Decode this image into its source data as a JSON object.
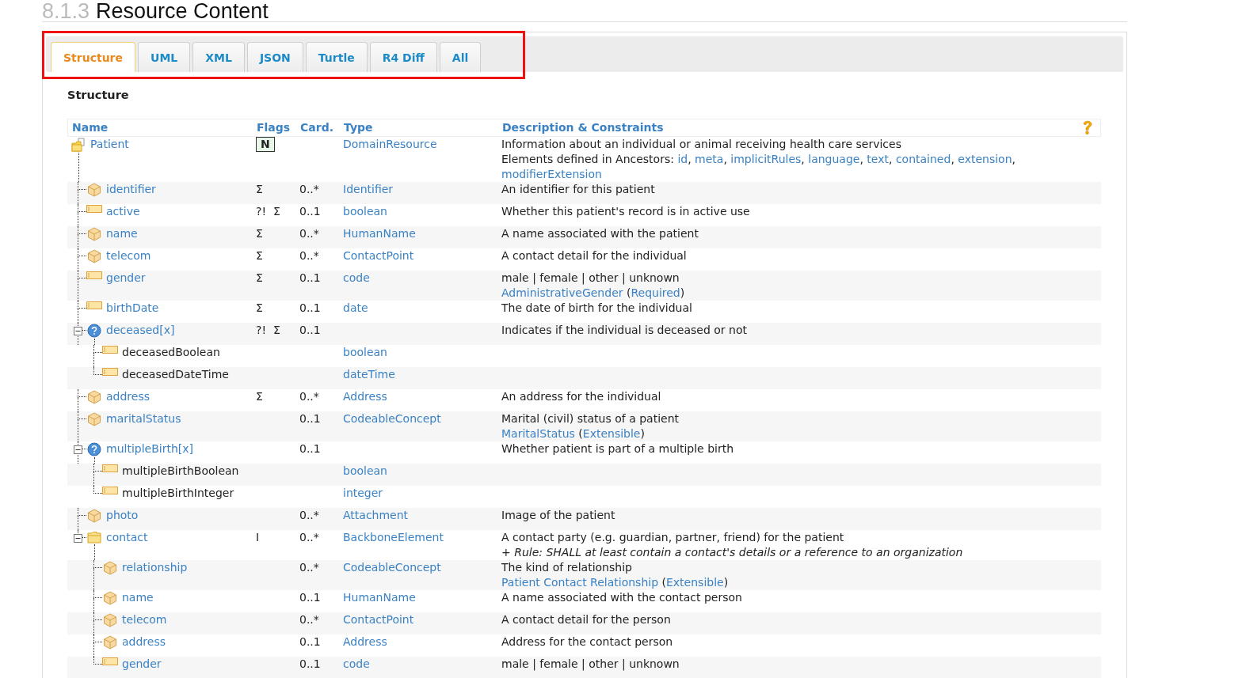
{
  "heading": {
    "number": "8.1.3",
    "title": "Resource Content"
  },
  "tabs": [
    {
      "label": "Structure",
      "selected": true
    },
    {
      "label": "UML",
      "selected": false
    },
    {
      "label": "XML",
      "selected": false
    },
    {
      "label": "JSON",
      "selected": false
    },
    {
      "label": "Turtle",
      "selected": false
    },
    {
      "label": "R4 Diff",
      "selected": false
    },
    {
      "label": "All",
      "selected": false
    }
  ],
  "section_title": "Structure",
  "table": {
    "columns": [
      "Name",
      "Flags",
      "Card.",
      "Type",
      "Description & Constraints"
    ],
    "rows": [
      {
        "name": "Patient",
        "kind": "resource",
        "linked": true,
        "flags": [
          {
            "text": "N",
            "boxed": true
          }
        ],
        "type": "DomainResource",
        "description": [
          [
            {
              "text": "Information about an individual or animal receiving health care services",
              "link": false
            }
          ],
          [
            {
              "text": "Elements defined in Ancestors: ",
              "link": false
            },
            {
              "text": "id",
              "link": true
            },
            {
              "text": ", ",
              "link": false
            },
            {
              "text": "meta",
              "link": true
            },
            {
              "text": ", ",
              "link": false
            },
            {
              "text": "implicitRules",
              "link": true
            },
            {
              "text": ", ",
              "link": false
            },
            {
              "text": "language",
              "link": true
            },
            {
              "text": ", ",
              "link": false
            },
            {
              "text": "text",
              "link": true
            },
            {
              "text": ", ",
              "link": false
            },
            {
              "text": "contained",
              "link": true
            },
            {
              "text": ", ",
              "link": false
            },
            {
              "text": "extension",
              "link": true
            },
            {
              "text": ",",
              "link": false
            }
          ],
          [
            {
              "text": "modifierExtension",
              "link": true
            }
          ]
        ],
        "children": [
          {
            "name": "identifier",
            "kind": "complex",
            "linked": true,
            "flags": [
              {
                "text": "Σ",
                "boxed": false
              }
            ],
            "card": "0..*",
            "type": "Identifier",
            "description": [
              [
                {
                  "text": "An identifier for this patient",
                  "link": false
                }
              ]
            ]
          },
          {
            "name": "active",
            "kind": "primitive",
            "linked": true,
            "flags": [
              {
                "text": "?!",
                "boxed": false
              },
              {
                "text": "Σ",
                "boxed": false
              }
            ],
            "card": "0..1",
            "type": "boolean",
            "description": [
              [
                {
                  "text": "Whether this patient's record is in active use",
                  "link": false
                }
              ]
            ]
          },
          {
            "name": "name",
            "kind": "complex",
            "linked": true,
            "flags": [
              {
                "text": "Σ",
                "boxed": false
              }
            ],
            "card": "0..*",
            "type": "HumanName",
            "description": [
              [
                {
                  "text": "A name associated with the patient",
                  "link": false
                }
              ]
            ]
          },
          {
            "name": "telecom",
            "kind": "complex",
            "linked": true,
            "flags": [
              {
                "text": "Σ",
                "boxed": false
              }
            ],
            "card": "0..*",
            "type": "ContactPoint",
            "description": [
              [
                {
                  "text": "A contact detail for the individual",
                  "link": false
                }
              ]
            ]
          },
          {
            "name": "gender",
            "kind": "primitive",
            "linked": true,
            "flags": [
              {
                "text": "Σ",
                "boxed": false
              }
            ],
            "card": "0..1",
            "type": "code",
            "description": [
              [
                {
                  "text": "male | female | other | unknown",
                  "link": false
                }
              ],
              [
                {
                  "text": "AdministrativeGender",
                  "link": true
                },
                {
                  "text": " (",
                  "link": false
                },
                {
                  "text": "Required",
                  "link": true
                },
                {
                  "text": ")",
                  "link": false
                }
              ]
            ]
          },
          {
            "name": "birthDate",
            "kind": "primitive",
            "linked": true,
            "flags": [
              {
                "text": "Σ",
                "boxed": false
              }
            ],
            "card": "0..1",
            "type": "date",
            "description": [
              [
                {
                  "text": "The date of birth for the individual",
                  "link": false
                }
              ]
            ]
          },
          {
            "name": "deceased[x]",
            "kind": "choice",
            "linked": true,
            "expanded": true,
            "flags": [
              {
                "text": "?!",
                "boxed": false
              },
              {
                "text": "Σ",
                "boxed": false
              }
            ],
            "card": "0..1",
            "description": [
              [
                {
                  "text": "Indicates if the individual is deceased or not",
                  "link": false
                }
              ]
            ],
            "children": [
              {
                "name": "deceasedBoolean",
                "kind": "primitive",
                "linked": false,
                "type": "boolean"
              },
              {
                "name": "deceasedDateTime",
                "kind": "primitive",
                "linked": false,
                "type": "dateTime"
              }
            ]
          },
          {
            "name": "address",
            "kind": "complex",
            "linked": true,
            "flags": [
              {
                "text": "Σ",
                "boxed": false
              }
            ],
            "card": "0..*",
            "type": "Address",
            "description": [
              [
                {
                  "text": "An address for the individual",
                  "link": false
                }
              ]
            ]
          },
          {
            "name": "maritalStatus",
            "kind": "complex",
            "linked": true,
            "card": "0..1",
            "type": "CodeableConcept",
            "description": [
              [
                {
                  "text": "Marital (civil) status of a patient",
                  "link": false
                }
              ],
              [
                {
                  "text": "MaritalStatus",
                  "link": true
                },
                {
                  "text": " (",
                  "link": false
                },
                {
                  "text": "Extensible",
                  "link": true
                },
                {
                  "text": ")",
                  "link": false
                }
              ]
            ]
          },
          {
            "name": "multipleBirth[x]",
            "kind": "choice",
            "linked": true,
            "expanded": true,
            "card": "0..1",
            "description": [
              [
                {
                  "text": "Whether patient is part of a multiple birth",
                  "link": false
                }
              ]
            ],
            "children": [
              {
                "name": "multipleBirthBoolean",
                "kind": "primitive",
                "linked": false,
                "type": "boolean"
              },
              {
                "name": "multipleBirthInteger",
                "kind": "primitive",
                "linked": false,
                "type": "integer"
              }
            ]
          },
          {
            "name": "photo",
            "kind": "complex",
            "linked": true,
            "card": "0..*",
            "type": "Attachment",
            "description": [
              [
                {
                  "text": "Image of the patient",
                  "link": false
                }
              ]
            ]
          },
          {
            "name": "contact",
            "kind": "backbone",
            "linked": true,
            "expanded": true,
            "flags": [
              {
                "text": "I",
                "boxed": false
              }
            ],
            "card": "0..*",
            "type": "BackboneElement",
            "description": [
              [
                {
                  "text": "A contact party (e.g. guardian, partner, friend) for the patient",
                  "link": false
                }
              ],
              [
                {
                  "text": "+ *Rule: SHALL at least contain a contact's details or a reference to an organization*",
                  "link": false
                }
              ]
            ],
            "children": [
              {
                "name": "relationship",
                "kind": "complex",
                "linked": true,
                "card": "0..*",
                "type": "CodeableConcept",
                "description": [
                  [
                    {
                      "text": "The kind of relationship",
                      "link": false
                    }
                  ],
                  [
                    {
                      "text": "Patient Contact Relationship",
                      "link": true
                    },
                    {
                      "text": " (",
                      "link": false
                    },
                    {
                      "text": "Extensible",
                      "link": true
                    },
                    {
                      "text": ")",
                      "link": false
                    }
                  ]
                ]
              },
              {
                "name": "name",
                "kind": "complex",
                "linked": true,
                "card": "0..1",
                "type": "HumanName",
                "description": [
                  [
                    {
                      "text": "A name associated with the contact person",
                      "link": false
                    }
                  ]
                ]
              },
              {
                "name": "telecom",
                "kind": "complex",
                "linked": true,
                "card": "0..*",
                "type": "ContactPoint",
                "description": [
                  [
                    {
                      "text": "A contact detail for the person",
                      "link": false
                    }
                  ]
                ]
              },
              {
                "name": "address",
                "kind": "complex",
                "linked": true,
                "card": "0..1",
                "type": "Address",
                "description": [
                  [
                    {
                      "text": "Address for the contact person",
                      "link": false
                    }
                  ]
                ]
              },
              {
                "name": "gender",
                "kind": "primitive",
                "linked": true,
                "card": "0..1",
                "type": "code",
                "description": [
                  [
                    {
                      "text": "male | female | other | unknown",
                      "link": false
                    }
                  ]
                ]
              }
            ]
          }
        ]
      }
    ]
  }
}
